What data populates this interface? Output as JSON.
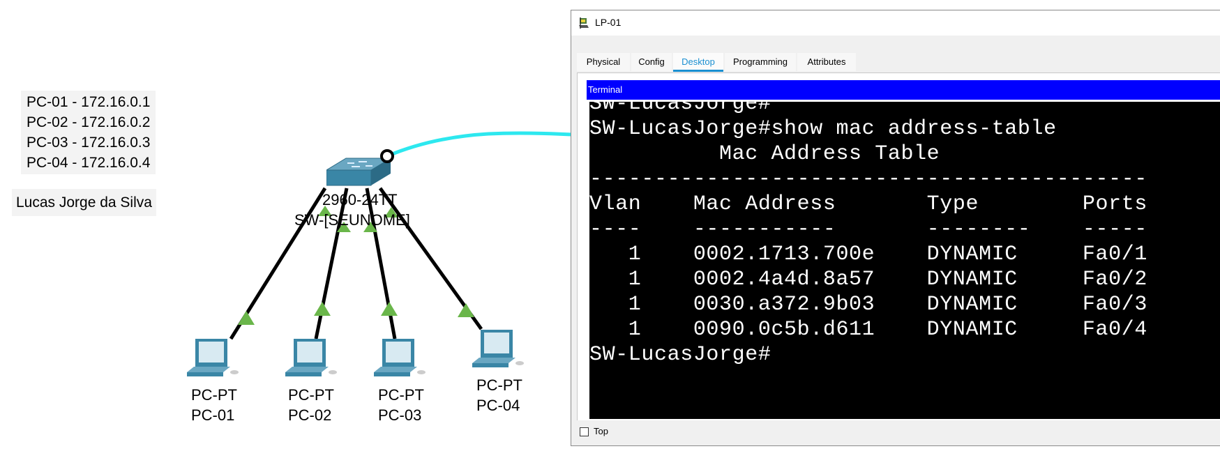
{
  "workspace": {
    "ip_notes": [
      "PC-01 - 172.16.0.1",
      "PC-02 - 172.16.0.2",
      "PC-03 - 172.16.0.3",
      "PC-04 - 172.16.0.4"
    ],
    "author_note": "Lucas Jorge da Silva",
    "switch": {
      "model": "2960-24TT",
      "name": "SW-[SEUNOME]"
    },
    "pcs": [
      {
        "model": "PC-PT",
        "name": "PC-01"
      },
      {
        "model": "PC-PT",
        "name": "PC-02"
      },
      {
        "model": "PC-PT",
        "name": "PC-03"
      },
      {
        "model": "PC-PT",
        "name": "PC-04"
      }
    ],
    "colors": {
      "link": "#000000",
      "link_up": "#6ab64a",
      "console_cable": "#2de8ef",
      "device": "#3a86a6"
    }
  },
  "window": {
    "title": "LP-01",
    "tabs": [
      "Physical",
      "Config",
      "Desktop",
      "Programming",
      "Attributes"
    ],
    "active_tab": "Desktop",
    "terminal_title": "Terminal",
    "terminal_lines": [
      "SW-LucasJorge#",
      "SW-LucasJorge#show mac address-table",
      "          Mac Address Table",
      "-------------------------------------------",
      "",
      "Vlan    Mac Address       Type        Ports",
      "----    -----------       --------    -----",
      "",
      "   1    0002.1713.700e    DYNAMIC     Fa0/1",
      "   1    0002.4a4d.8a57    DYNAMIC     Fa0/2",
      "   1    0030.a372.9b03    DYNAMIC     Fa0/3",
      "   1    0090.0c5b.d611    DYNAMIC     Fa0/4",
      "SW-LucasJorge#"
    ],
    "top_checkbox_label": "Top",
    "top_checked": false,
    "colors": {
      "accent": "#1a8fd1",
      "terminal_header": "#0000ff",
      "terminal_bg": "#000000",
      "terminal_fg": "#ffffff"
    }
  }
}
